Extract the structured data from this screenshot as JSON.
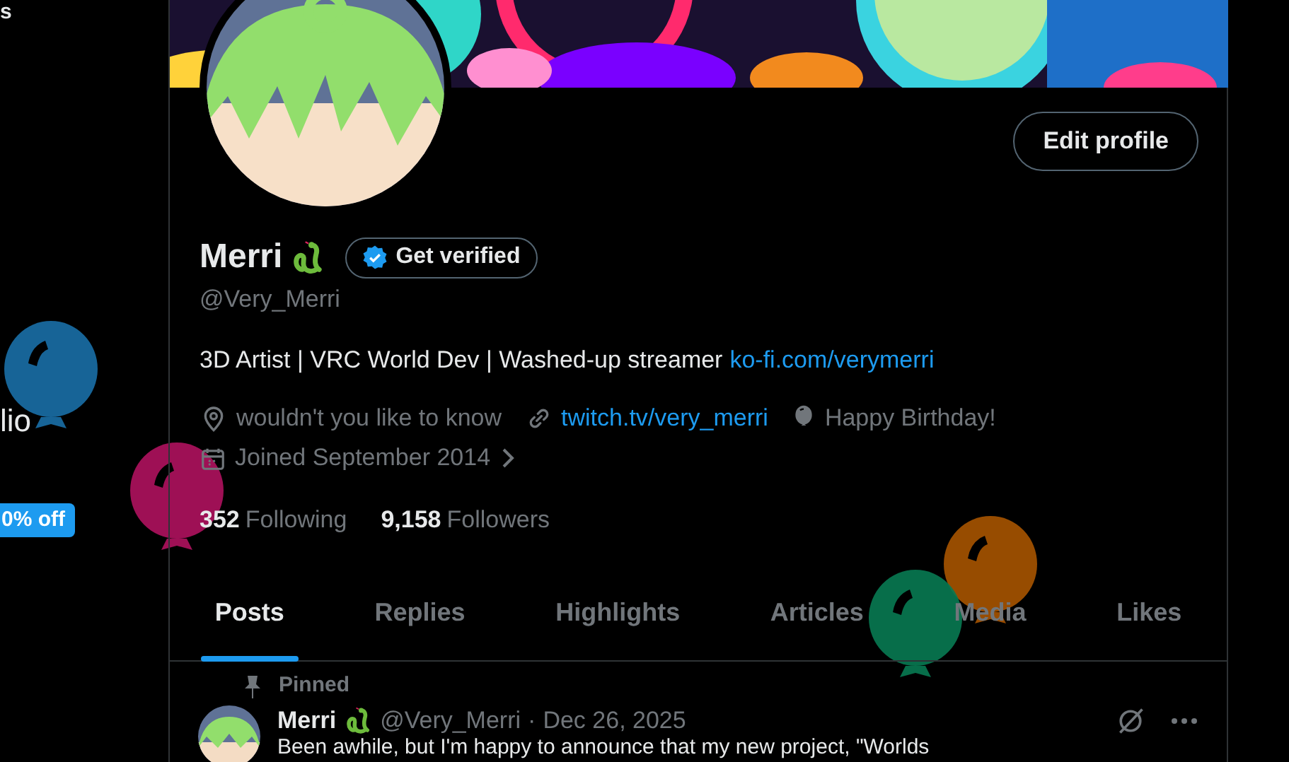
{
  "sidebar_fragments": [
    {
      "text": "s"
    },
    {
      "text": "lio"
    }
  ],
  "promo_badge": "0% off",
  "profile": {
    "name": "Merri",
    "verify_button": "Get verified",
    "handle": "@Very_Merri",
    "bio": "3D Artist | VRC World Dev | Washed-up streamer",
    "bio_link": "ko-fi.com/verymerri",
    "edit_button": "Edit profile",
    "meta": [
      {
        "kind": "location",
        "text": "wouldn't you like to know"
      },
      {
        "kind": "link",
        "text": "twitch.tv/very_merri"
      },
      {
        "kind": "birthday",
        "text": "Happy Birthday!"
      },
      {
        "kind": "joined",
        "text": "Joined September 2014"
      }
    ],
    "stats": [
      {
        "count": "352",
        "label": "Following"
      },
      {
        "count": "9,158",
        "label": "Followers"
      }
    ]
  },
  "tabs": [
    {
      "label": "Posts",
      "selected": true
    },
    {
      "label": "Replies",
      "selected": false
    },
    {
      "label": "Highlights",
      "selected": false
    },
    {
      "label": "Articles",
      "selected": false
    },
    {
      "label": "Media",
      "selected": false
    },
    {
      "label": "Likes",
      "selected": false
    }
  ],
  "post": {
    "pinned_label": "Pinned",
    "author": "Merri",
    "handle": "@Very_Merri",
    "separator": "·",
    "date": "Dec 26, 2025",
    "text": "Been awhile, but I'm happy to announce that my new project, \"Worlds"
  }
}
